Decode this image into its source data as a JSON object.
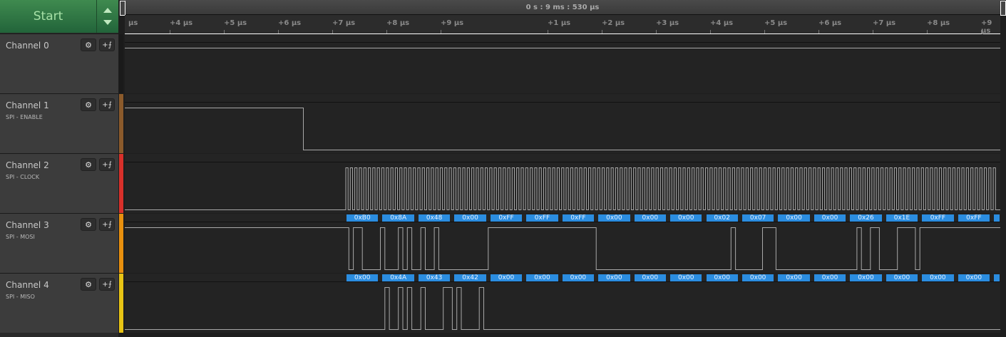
{
  "controls": {
    "start_label": "Start"
  },
  "timeline": {
    "position": "0 s : 9 ms : 530 µs",
    "ticks": [
      "µs",
      "+4 µs",
      "+5 µs",
      "+6 µs",
      "+7 µs",
      "+8 µs",
      "+9 µs",
      "+1 µs",
      "+2 µs",
      "+3 µs",
      "+4 µs",
      "+5 µs",
      "+6 µs",
      "+7 µs",
      "+8 µs",
      "+9 µs"
    ]
  },
  "channels": [
    {
      "name": "Channel 0",
      "analyzer": "",
      "color": "#1a1a1a"
    },
    {
      "name": "Channel 1",
      "analyzer": "SPI - ENABLE",
      "color": "#8b5a2b"
    },
    {
      "name": "Channel 2",
      "analyzer": "SPI - CLOCK",
      "color": "#d8302a"
    },
    {
      "name": "Channel 3",
      "analyzer": "SPI - MOSI",
      "color": "#e8900e"
    },
    {
      "name": "Channel 4",
      "analyzer": "SPI - MISO",
      "color": "#e8c414"
    }
  ],
  "icons": {
    "settings": "gear-icon",
    "trigger": "rising-edge-trigger-icon"
  },
  "decoded": {
    "mosi": [
      "0xB0",
      "0x8A",
      "0x48",
      "0x00",
      "0xFF",
      "0xFF",
      "0xFF",
      "0x00",
      "0x00",
      "0x00",
      "0x02",
      "0x07",
      "0x00",
      "0x00",
      "0x26",
      "0x1E",
      "0xFF",
      "0xFF"
    ],
    "miso": [
      "0x00",
      "0x4A",
      "0x43",
      "0x42",
      "0x00",
      "0x00",
      "0x00",
      "0x00",
      "0x00",
      "0x00",
      "0x00",
      "0x00",
      "0x00",
      "0x00",
      "0x00",
      "0x00",
      "0x00",
      "0x00"
    ],
    "label_color": "#2b8de0"
  }
}
